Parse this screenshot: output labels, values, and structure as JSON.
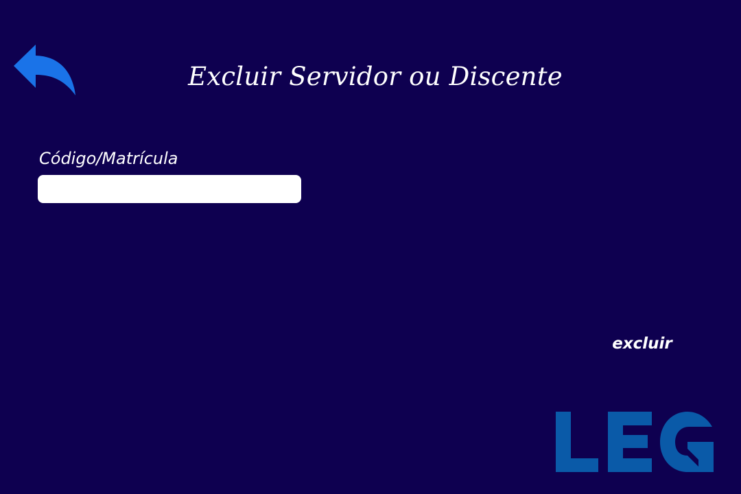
{
  "header": {
    "title": "Excluir Servidor ou Discente",
    "back_icon": "undo-arrow-icon"
  },
  "form": {
    "code_label": "Código/Matrícula",
    "code_value": "",
    "code_placeholder": ""
  },
  "actions": {
    "delete_label": "excluir"
  },
  "branding": {
    "logo_text": "LEG",
    "logo_color": "#0a5aa8"
  },
  "colors": {
    "background": "#0e0050",
    "accent_blue": "#1a73e8",
    "text": "#ffffff",
    "input_background": "#ffffff"
  }
}
